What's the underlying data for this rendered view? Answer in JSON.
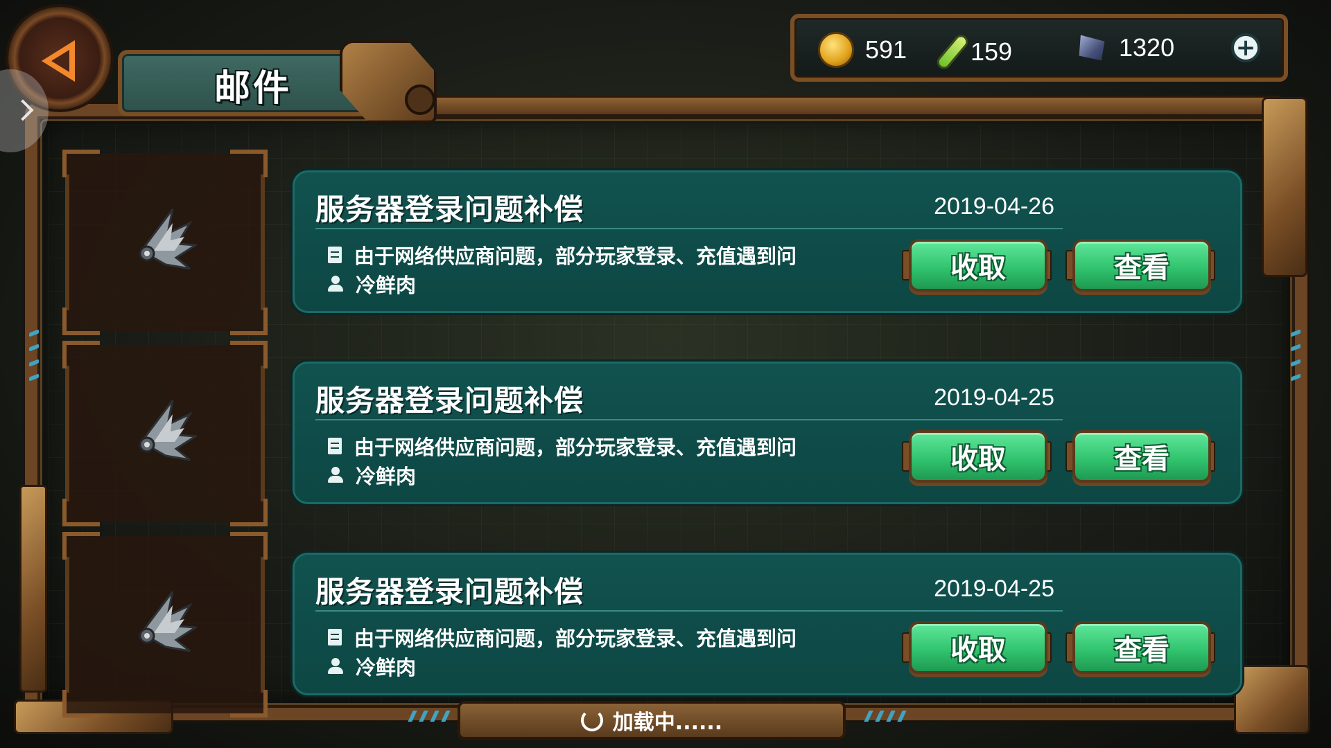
{
  "header": {
    "title": "邮件"
  },
  "currency": {
    "gold": "591",
    "potion": "159",
    "crystal": "1320",
    "add_label": "+"
  },
  "mails": [
    {
      "title": "服务器登录问题补偿",
      "date": "2019-04-26",
      "preview": "由于网络供应商问题，部分玩家登录、充值遇到问",
      "sender": "冷鲜肉",
      "collect_label": "收取",
      "view_label": "查看",
      "icon": "wing-icon"
    },
    {
      "title": "服务器登录问题补偿",
      "date": "2019-04-25",
      "preview": "由于网络供应商问题，部分玩家登录、充值遇到问",
      "sender": "冷鲜肉",
      "collect_label": "收取",
      "view_label": "查看",
      "icon": "wing-icon"
    },
    {
      "title": "服务器登录问题补偿",
      "date": "2019-04-25",
      "preview": "由于网络供应商问题，部分玩家登录、充值遇到问",
      "sender": "冷鲜肉",
      "collect_label": "收取",
      "view_label": "查看",
      "icon": "wing-icon"
    }
  ],
  "footer": {
    "loading_text": "加载中......"
  },
  "colors": {
    "card_bg": "#0d4744",
    "button_green": "#32c46f",
    "frame_bronze": "#7a4f26",
    "accent_orange": "#f3892b"
  }
}
